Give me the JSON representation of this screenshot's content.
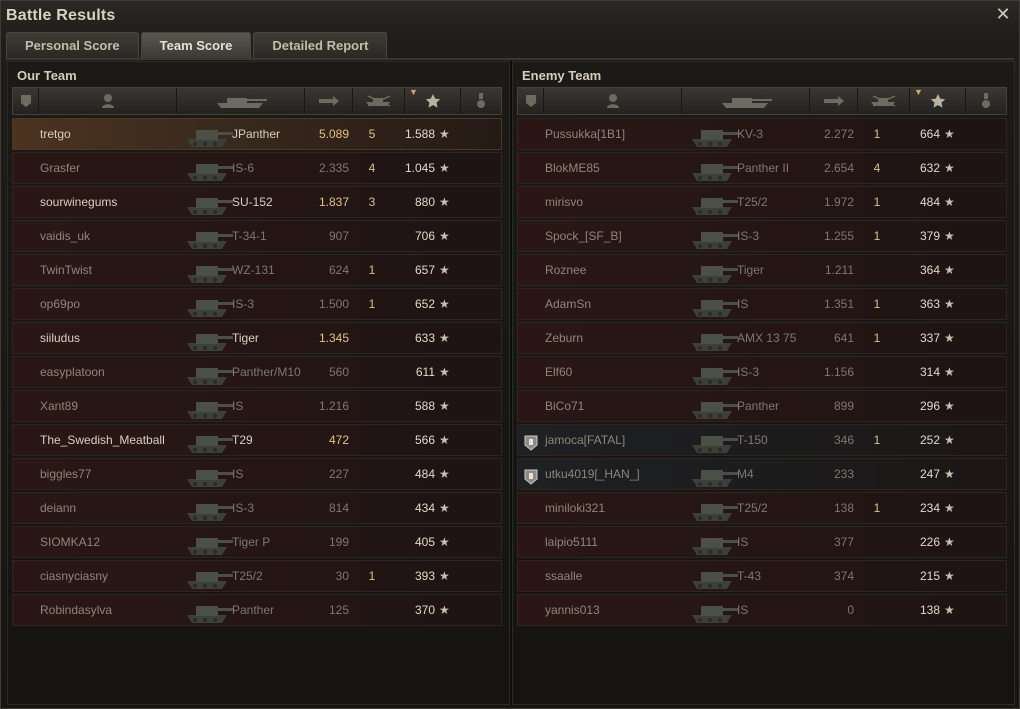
{
  "window": {
    "title": "Battle Results",
    "close_icon": "close-icon",
    "tabs": [
      {
        "label": "Personal Score",
        "active": false
      },
      {
        "label": "Team Score",
        "active": true
      },
      {
        "label": "Detailed Report",
        "active": false
      }
    ]
  },
  "colors": {
    "accent_gold": "#e4c27a",
    "row_red": "#2a1715",
    "highlight_row": "#4c3320",
    "text_light": "#d7d0c0",
    "text_dim": "#8d8679"
  },
  "columns_icons": [
    "squad-icon",
    "player-icon",
    "vehicle-icon",
    "damage-icon",
    "kills-icon",
    "xp-star-icon",
    "medal-icon"
  ],
  "our_team": {
    "title": "Our Team",
    "rows": [
      {
        "name": "tretgo",
        "tank": "JPanther",
        "damage": "5.089",
        "kills": "5",
        "xp": "1.588",
        "alive": true,
        "highlight": true
      },
      {
        "name": "Grasfer",
        "tank": "IS-6",
        "damage": "2.335",
        "kills": "4",
        "xp": "1.045",
        "alive": false
      },
      {
        "name": "sourwinegums",
        "tank": "SU-152",
        "damage": "1.837",
        "kills": "3",
        "xp": "880",
        "alive": true
      },
      {
        "name": "vaidis_uk",
        "tank": "T-34-1",
        "damage": "907",
        "kills": "",
        "xp": "706",
        "alive": false
      },
      {
        "name": "TwinTwist",
        "tank": "WZ-131",
        "damage": "624",
        "kills": "1",
        "xp": "657",
        "alive": false
      },
      {
        "name": "op69po",
        "tank": "IS-3",
        "damage": "1.500",
        "kills": "1",
        "xp": "652",
        "alive": false
      },
      {
        "name": "siiludus",
        "tank": "Tiger",
        "damage": "1.345",
        "kills": "",
        "xp": "633",
        "alive": true
      },
      {
        "name": "easyplatoon",
        "tank": "Panther/M10",
        "damage": "560",
        "kills": "",
        "xp": "611",
        "alive": false
      },
      {
        "name": "Xant89",
        "tank": "IS",
        "damage": "1.216",
        "kills": "",
        "xp": "588",
        "alive": false
      },
      {
        "name": "The_Swedish_Meatball",
        "tank": "T29",
        "damage": "472",
        "kills": "",
        "xp": "566",
        "alive": true
      },
      {
        "name": "biggles77",
        "tank": "IS",
        "damage": "227",
        "kills": "",
        "xp": "484",
        "alive": false
      },
      {
        "name": "deiann",
        "tank": "IS-3",
        "damage": "814",
        "kills": "",
        "xp": "434",
        "alive": false
      },
      {
        "name": "SIOMKA12",
        "tank": "Tiger P",
        "damage": "199",
        "kills": "",
        "xp": "405",
        "alive": false
      },
      {
        "name": "ciasnyciasny",
        "tank": "T25/2",
        "damage": "30",
        "kills": "1",
        "xp": "393",
        "alive": false
      },
      {
        "name": "Robindasylva",
        "tank": "Panther",
        "damage": "125",
        "kills": "",
        "xp": "370",
        "alive": false
      }
    ]
  },
  "enemy_team": {
    "title": "Enemy Team",
    "rows": [
      {
        "name": "Pussukka[1B1]",
        "tank": "KV-3",
        "damage": "2.272",
        "kills": "1",
        "xp": "664",
        "platoon": false
      },
      {
        "name": "BlokME85",
        "tank": "Panther II",
        "damage": "2.654",
        "kills": "4",
        "xp": "632",
        "platoon": false
      },
      {
        "name": "mirisvo",
        "tank": "T25/2",
        "damage": "1.972",
        "kills": "1",
        "xp": "484",
        "platoon": false
      },
      {
        "name": "Spock_[SF_B]",
        "tank": "IS-3",
        "damage": "1.255",
        "kills": "1",
        "xp": "379",
        "platoon": false
      },
      {
        "name": "Roznee",
        "tank": "Tiger",
        "damage": "1.211",
        "kills": "",
        "xp": "364",
        "platoon": false
      },
      {
        "name": "AdamSn",
        "tank": "IS",
        "damage": "1.351",
        "kills": "1",
        "xp": "363",
        "platoon": false
      },
      {
        "name": "Zeburn",
        "tank": "AMX 13 75",
        "damage": "641",
        "kills": "1",
        "xp": "337",
        "platoon": false
      },
      {
        "name": "Elf60",
        "tank": "IS-3",
        "damage": "1.156",
        "kills": "",
        "xp": "314",
        "platoon": false
      },
      {
        "name": "BiCo71",
        "tank": "Panther",
        "damage": "899",
        "kills": "",
        "xp": "296",
        "platoon": false
      },
      {
        "name": "jamoca[FATAL]",
        "tank": "T-150",
        "damage": "346",
        "kills": "1",
        "xp": "252",
        "platoon": true
      },
      {
        "name": "utku4019[_HAN_]",
        "tank": "M4",
        "damage": "233",
        "kills": "",
        "xp": "247",
        "platoon": true
      },
      {
        "name": "miniloki321",
        "tank": "T25/2",
        "damage": "138",
        "kills": "1",
        "xp": "234",
        "platoon": false
      },
      {
        "name": "laipio5111",
        "tank": "IS",
        "damage": "377",
        "kills": "",
        "xp": "226",
        "platoon": false
      },
      {
        "name": "ssaalle",
        "tank": "T-43",
        "damage": "374",
        "kills": "",
        "xp": "215",
        "platoon": false
      },
      {
        "name": "yannis013",
        "tank": "IS",
        "damage": "0",
        "kills": "",
        "xp": "138",
        "platoon": false
      }
    ]
  }
}
